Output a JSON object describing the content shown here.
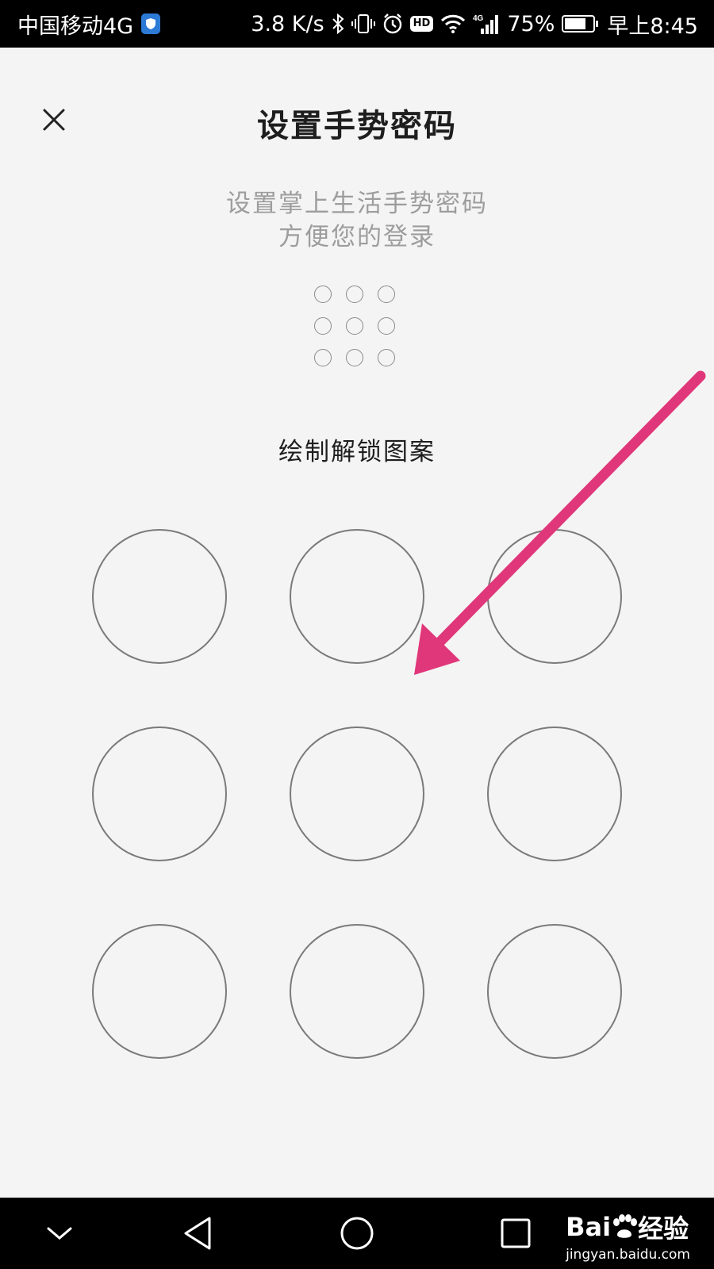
{
  "status_bar": {
    "carrier": "中国移动4G",
    "speed": "3.8 K/s",
    "network_badge": "4G",
    "hd_badge": "HD",
    "battery_percent": "75%",
    "battery_level": 0.75,
    "time": "早上8:45"
  },
  "header": {
    "title": "设置手势密码"
  },
  "subtitle": {
    "line1": "设置掌上生活手势密码",
    "line2": "方便您的登录"
  },
  "instruction": "绘制解锁图案",
  "pattern": {
    "nodes": [
      "1",
      "2",
      "3",
      "4",
      "5",
      "6",
      "7",
      "8",
      "9"
    ]
  },
  "annotation": {
    "arrow_color": "#e0377a"
  },
  "watermark": {
    "brand_left": "Bai",
    "brand_right": "经验",
    "url": "jingyan.baidu.com"
  },
  "colors": {
    "background": "#f4f4f4",
    "status_bar": "#000000",
    "title_text": "#1e1e1e",
    "subtitle_text": "#9d9d9d",
    "node_stroke": "#7a7a7a"
  }
}
